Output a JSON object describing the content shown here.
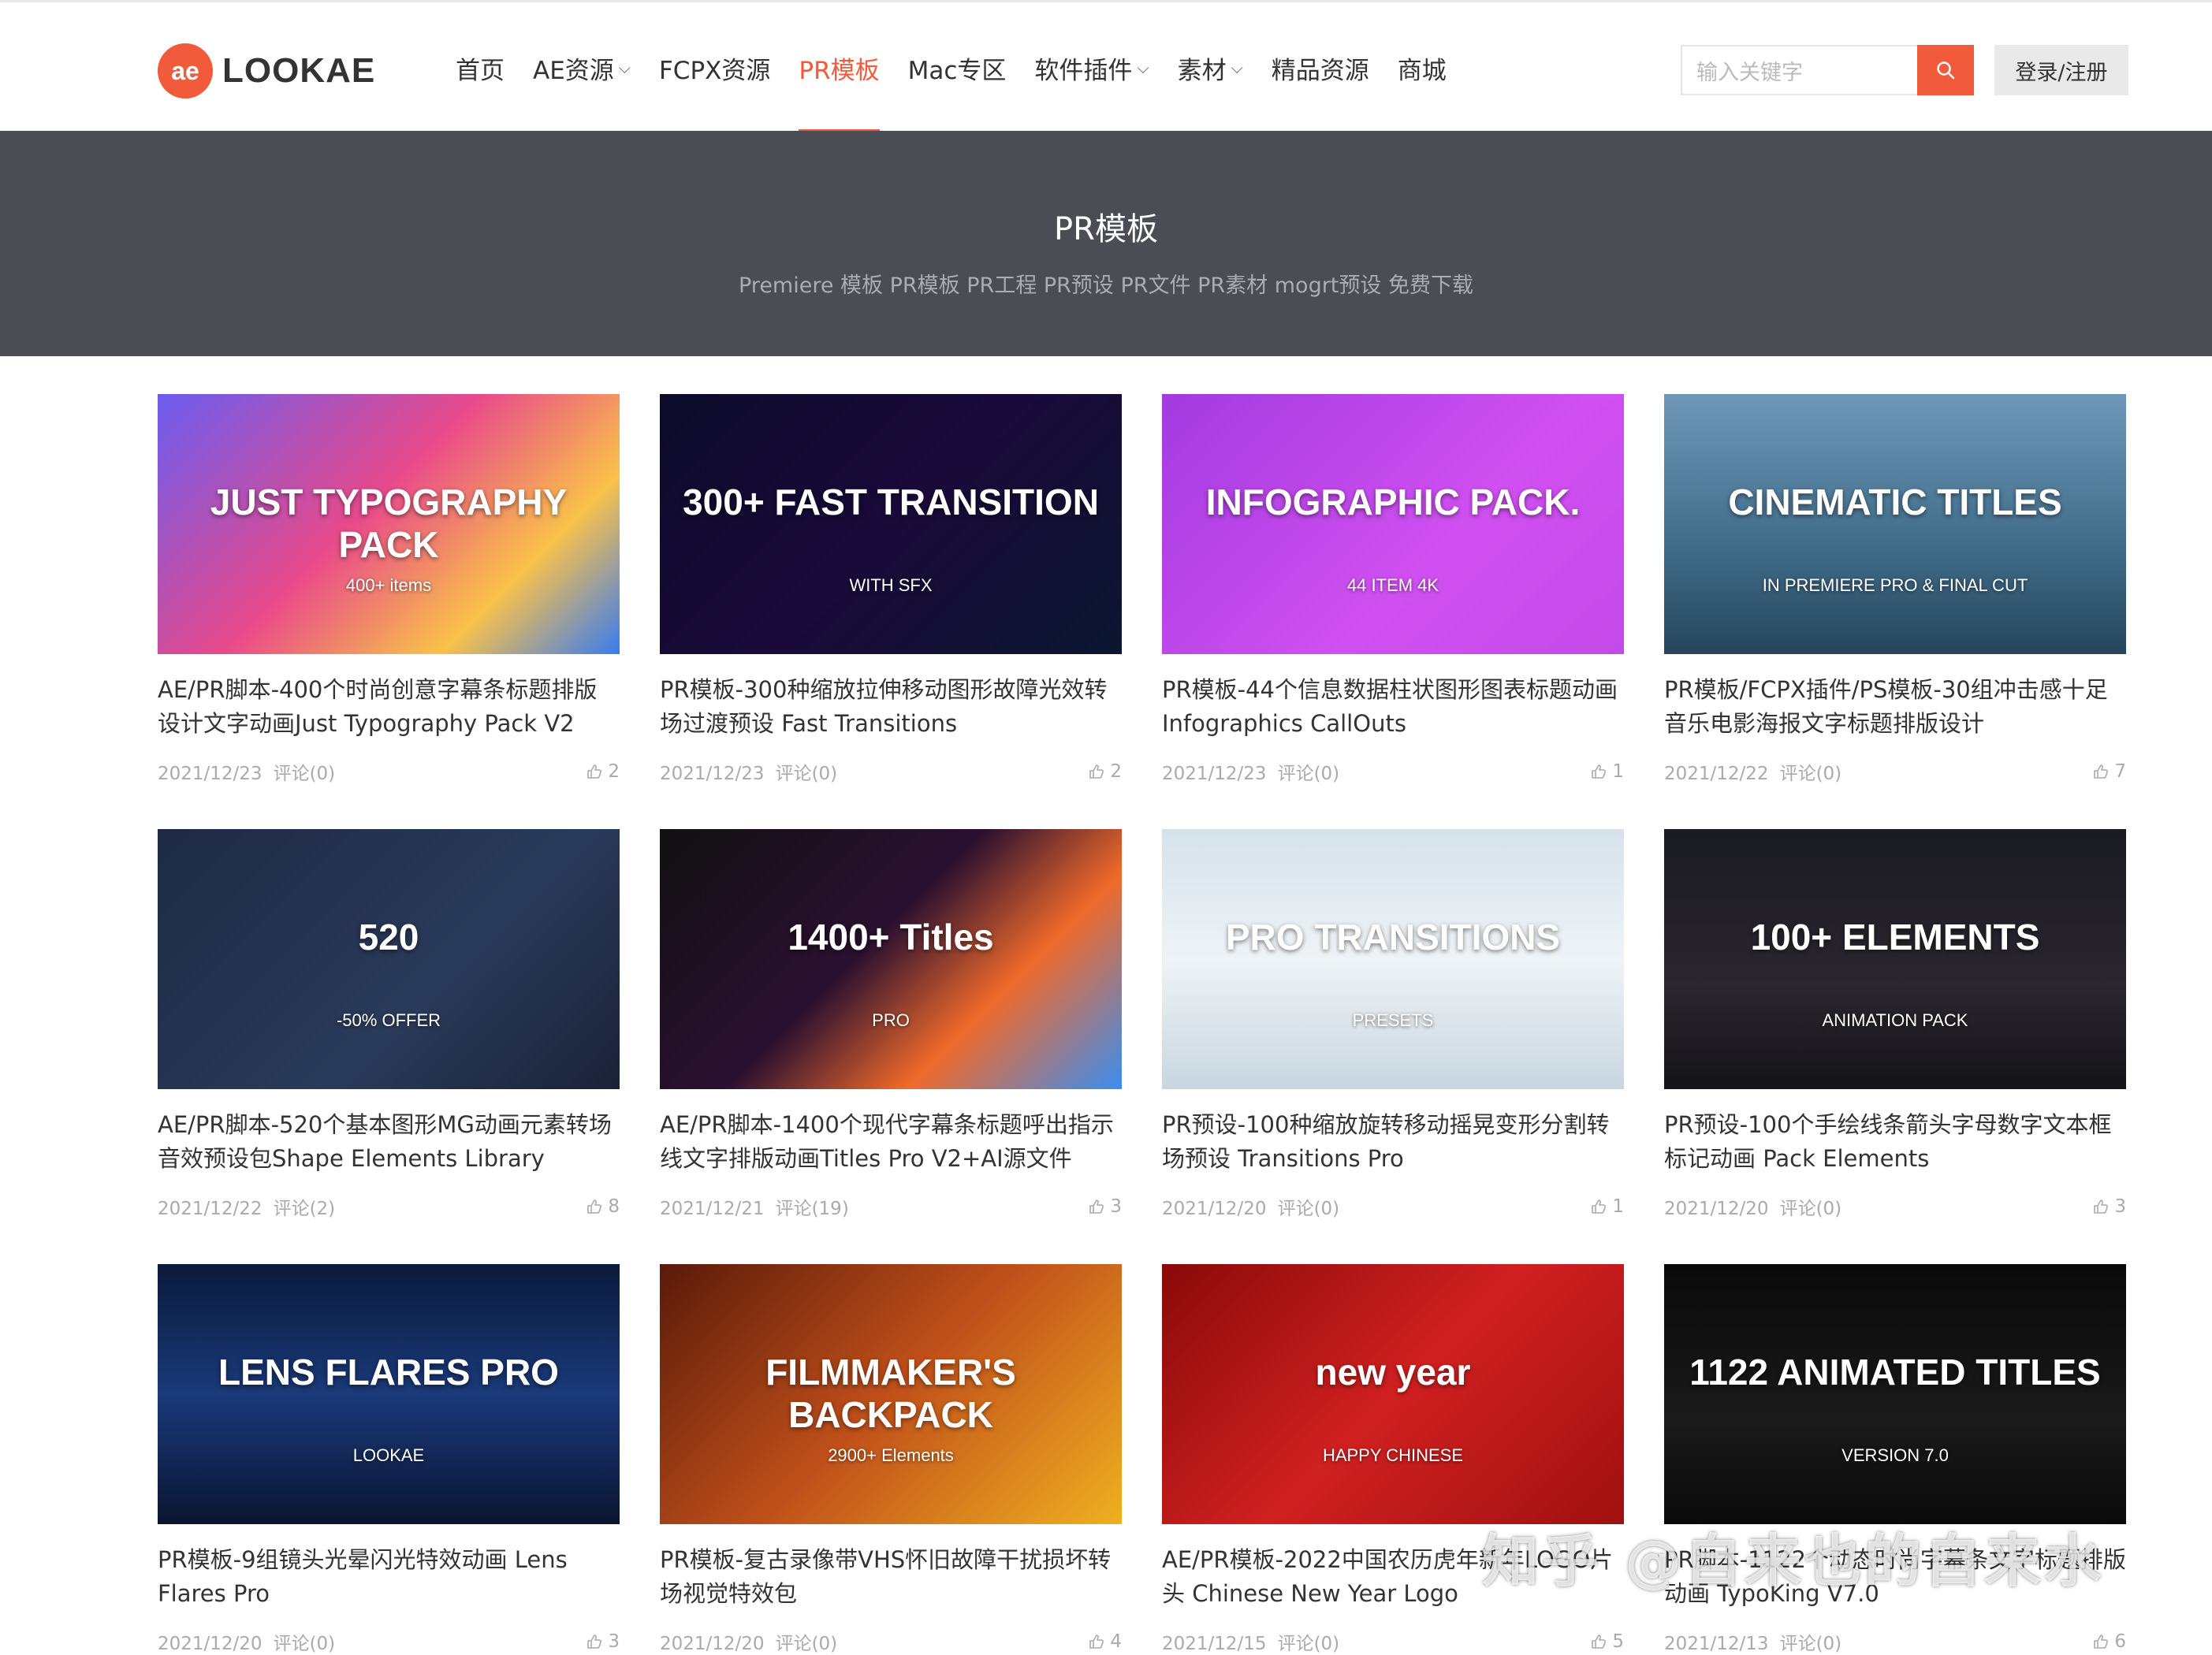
{
  "header": {
    "logo_badge": "ae",
    "logo_text": "LOOKAE",
    "nav": [
      {
        "label": "首页",
        "dropdown": false
      },
      {
        "label": "AE资源",
        "dropdown": true
      },
      {
        "label": "FCPX资源",
        "dropdown": false
      },
      {
        "label": "PR模板",
        "dropdown": false,
        "active": true
      },
      {
        "label": "Mac专区",
        "dropdown": false
      },
      {
        "label": "软件插件",
        "dropdown": true
      },
      {
        "label": "素材",
        "dropdown": true
      },
      {
        "label": "精品资源",
        "dropdown": false
      },
      {
        "label": "商城",
        "dropdown": false
      }
    ],
    "search_placeholder": "输入关键字",
    "login_label": "登录/注册"
  },
  "banner": {
    "title": "PR模板",
    "subtitle": "Premiere 模板 PR模板 PR工程 PR预设 PR文件 PR素材 mogrt预设 免费下载"
  },
  "cards": [
    {
      "title": "AE/PR脚本-400个时尚创意字幕条标题排版设计文字动画Just Typography Pack V2",
      "date": "2021/12/23",
      "comments": "评论(0)",
      "likes": "2",
      "thumb_text": "JUST TYPOGRAPHY PACK",
      "thumb_sub": "400+ items",
      "bg": "linear-gradient(135deg,#6a5cf0 0%,#e84a8a 45%,#f9c24a 75%,#3a7bf0 100%)"
    },
    {
      "title": "PR模板-300种缩放拉伸移动图形故障光效转场过渡预设 Fast Transitions",
      "date": "2021/12/23",
      "comments": "评论(0)",
      "likes": "2",
      "thumb_text": "300+ FAST TRANSITION",
      "thumb_sub": "WITH SFX",
      "bg": "linear-gradient(135deg,#0b0b2a 0%,#1a0a3a 50%,#0b1630 100%)"
    },
    {
      "title": "PR模板-44个信息数据柱状图形图表标题动画 Infographics CallOuts",
      "date": "2021/12/23",
      "comments": "评论(0)",
      "likes": "1",
      "thumb_text": "INFOGRAPHIC PACK.",
      "thumb_sub": "44 ITEM 4K",
      "bg": "linear-gradient(135deg,#a23be0 0%,#d04ff0 60%,#c44ae8 100%)"
    },
    {
      "title": "PR模板/FCPX插件/PS模板-30组冲击感十足音乐电影海报文字标题排版设计",
      "date": "2021/12/22",
      "comments": "评论(0)",
      "likes": "7",
      "thumb_text": "CINEMATIC TITLES",
      "thumb_sub": "IN PREMIERE PRO & FINAL CUT",
      "bg": "linear-gradient(180deg,#6f98b8 0%,#3f6b88 60%,#26455c 100%)"
    },
    {
      "title": "AE/PR脚本-520个基本图形MG动画元素转场音效预设包Shape Elements Library",
      "date": "2021/12/22",
      "comments": "评论(2)",
      "likes": "8",
      "thumb_text": "520",
      "thumb_sub": "-50% OFFER",
      "bg": "linear-gradient(135deg,#1d2a44 0%,#2a3a5a 60%,#1a2236 100%)"
    },
    {
      "title": "AE/PR脚本-1400个现代字幕条标题呼出指示线文字排版动画Titles Pro V2+AI源文件",
      "date": "2021/12/21",
      "comments": "评论(19)",
      "likes": "3",
      "thumb_text": "1400+ Titles",
      "thumb_sub": "PRO",
      "bg": "linear-gradient(135deg,#111 0%,#2a1030 45%,#f06a2a 70%,#3a8ef0 100%)"
    },
    {
      "title": "PR预设-100种缩放旋转移动摇晃变形分割转场预设 Transitions Pro",
      "date": "2021/12/20",
      "comments": "评论(0)",
      "likes": "1",
      "thumb_text": "PRO TRANSITIONS",
      "thumb_sub": "PRESETS",
      "bg": "linear-gradient(180deg,#d6e2ea 0%,#eef3f6 50%,#c9d6df 100%)"
    },
    {
      "title": "PR预设-100个手绘线条箭头字母数字文本框标记动画 Pack Elements",
      "date": "2021/12/20",
      "comments": "评论(0)",
      "likes": "3",
      "thumb_text": "100+ ELEMENTS",
      "thumb_sub": "ANIMATION PACK",
      "bg": "linear-gradient(180deg,#1a1a22 0%,#2b2630 60%,#141418 100%)"
    },
    {
      "title": "PR模板-9组镜头光晕闪光特效动画 Lens Flares Pro",
      "date": "2021/12/20",
      "comments": "评论(0)",
      "likes": "3",
      "thumb_text": "LENS FLARES PRO",
      "thumb_sub": "LOOKAE",
      "bg": "linear-gradient(180deg,#0a1a3a 0%,#1a3a7a 50%,#0a1530 100%)"
    },
    {
      "title": "PR模板-复古录像带VHS怀旧故障干扰损坏转场视觉特效包",
      "date": "2021/12/20",
      "comments": "评论(0)",
      "likes": "4",
      "thumb_text": "FILMMAKER'S BACKPACK",
      "thumb_sub": "2900+ Elements",
      "bg": "linear-gradient(135deg,#5a1a0a 0%,#c0501a 50%,#f0b020 100%)"
    },
    {
      "title": "AE/PR模板-2022中国农历虎年新年LOGO片头 Chinese New Year Logo",
      "date": "2021/12/15",
      "comments": "评论(0)",
      "likes": "5",
      "thumb_text": "new year",
      "thumb_sub": "HAPPY CHINESE",
      "bg": "linear-gradient(135deg,#8a0a0a 0%,#d02020 50%,#a01010 100%)"
    },
    {
      "title": "PR脚本-1122个动态时尚字幕条文字标题排版动画 TypoKing V7.0",
      "date": "2021/12/13",
      "comments": "评论(0)",
      "likes": "6",
      "thumb_text": "1122 ANIMATED TITLES",
      "thumb_sub": "VERSION 7.0",
      "bg": "linear-gradient(180deg,#0a0a0a 0%,#1a1a1a 60%,#0a0a0a 100%)"
    }
  ],
  "watermark": "知乎 @自来也的自来水"
}
